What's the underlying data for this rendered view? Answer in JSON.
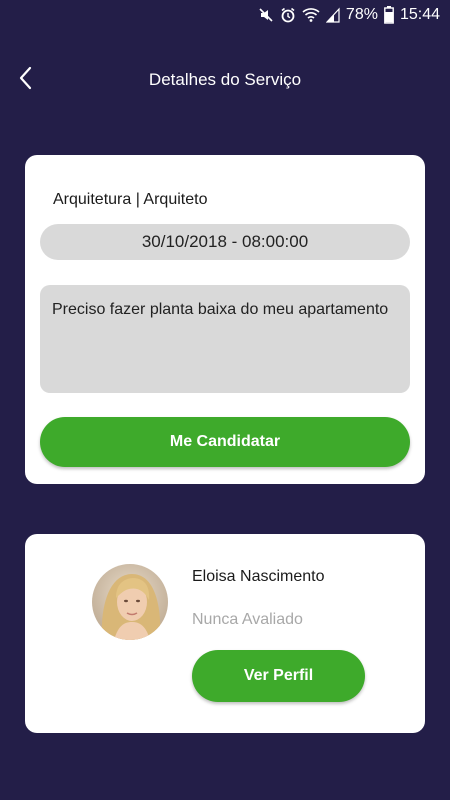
{
  "status_bar": {
    "battery": "78%",
    "time": "15:44",
    "icons": [
      "mute-icon",
      "alarm-icon",
      "wifi-icon",
      "signal-icon",
      "battery-icon"
    ]
  },
  "app_bar": {
    "title": "Detalhes do Serviço",
    "back_icon": "chevron-left-icon"
  },
  "service": {
    "category": "Arquitetura | Arquiteto",
    "datetime": "30/10/2018 - 08:00:00",
    "description": "Preciso fazer planta baixa do meu apartamento",
    "apply_label": "Me Candidatar"
  },
  "profile": {
    "name": "Eloisa Nascimento",
    "rating": "Nunca Avaliado",
    "view_label": "Ver Perfil"
  },
  "colors": {
    "background": "#231e48",
    "card": "#ffffff",
    "accent_green": "#3eaa2b",
    "field_gray": "#d9d9d9",
    "muted_text": "#a8a8a8"
  }
}
